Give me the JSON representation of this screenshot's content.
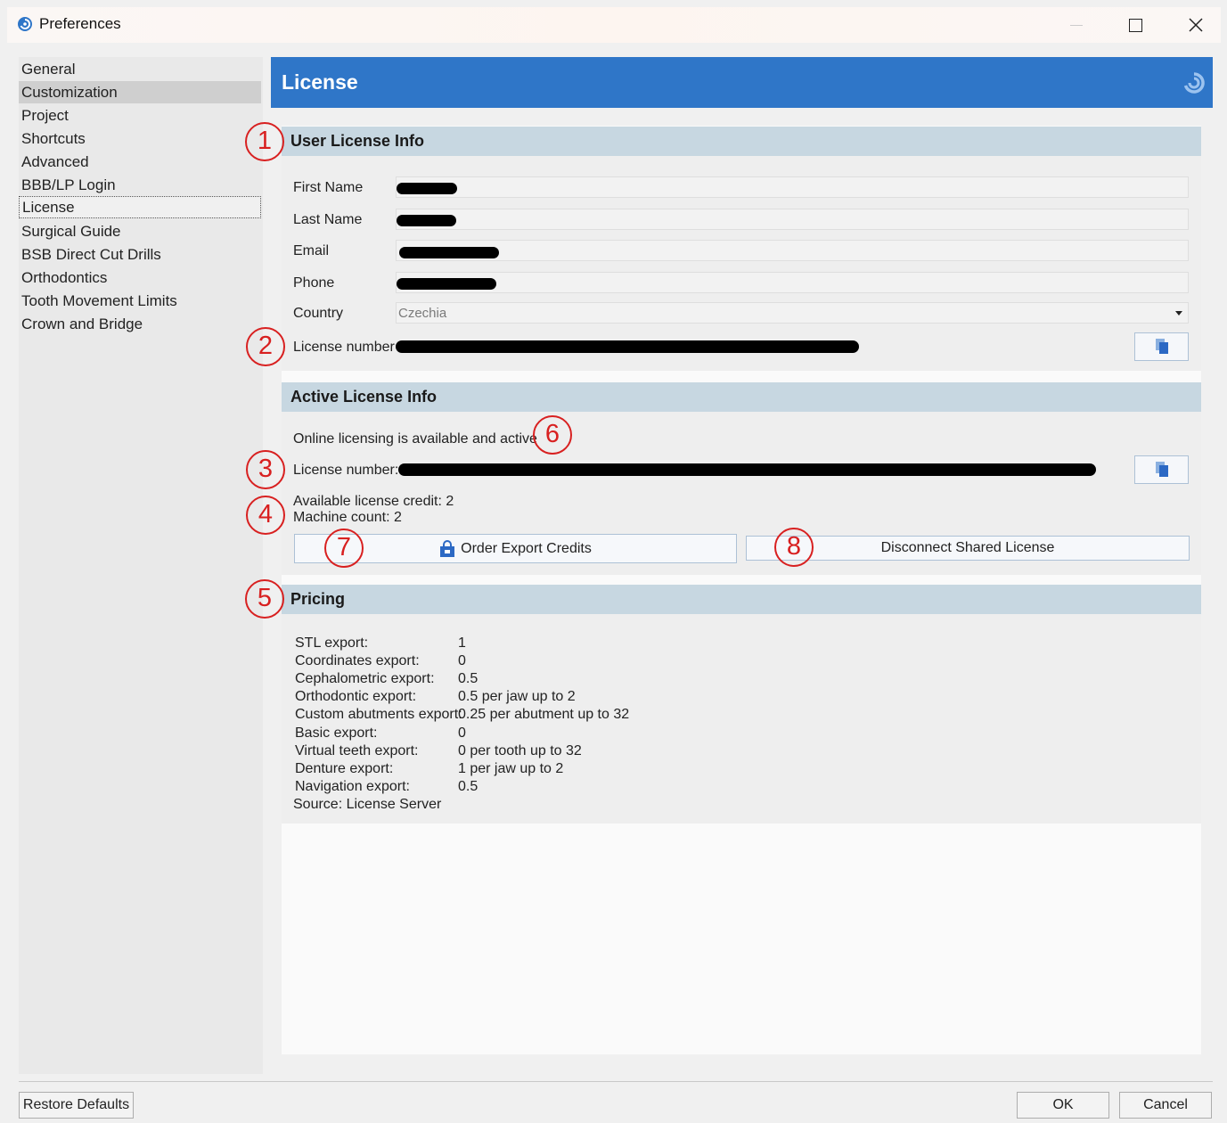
{
  "window": {
    "title": "Preferences"
  },
  "sidebar": {
    "items": [
      {
        "label": "General"
      },
      {
        "label": "Customization"
      },
      {
        "label": "Project"
      },
      {
        "label": "Shortcuts"
      },
      {
        "label": "Advanced"
      },
      {
        "label": "BBB/LP Login"
      },
      {
        "label": "License"
      },
      {
        "label": "Surgical Guide"
      },
      {
        "label": "BSB Direct Cut Drills"
      },
      {
        "label": "Orthodontics"
      },
      {
        "label": "Tooth Movement Limits"
      },
      {
        "label": "Crown and Bridge"
      }
    ],
    "selected": "Customization",
    "focused": "License"
  },
  "header": {
    "title": "License",
    "accent_color": "#2f76c8"
  },
  "user_license_info": {
    "title": "User License Info",
    "first_name_label": "First Name",
    "last_name_label": "Last Name",
    "email_label": "Email",
    "phone_label": "Phone",
    "country_label": "Country",
    "country_value": "Czechia",
    "license_number_label": "License number",
    "copy_icon": "copy-icon"
  },
  "active_license_info": {
    "title": "Active License Info",
    "status": "Online licensing is available and active",
    "license_number_label": "License number:",
    "credit_text": "Available license credit: 2",
    "machine_count_text": "Machine count: 2",
    "order_button": "Order Export Credits",
    "order_icon": "lock-bag-icon",
    "disconnect_button": "Disconnect Shared License"
  },
  "pricing": {
    "title": "Pricing",
    "rows": [
      {
        "label": "STL export:",
        "value": "1"
      },
      {
        "label": "Coordinates export:",
        "value": "0"
      },
      {
        "label": "Cephalometric export:",
        "value": "0.5"
      },
      {
        "label": "Orthodontic export:",
        "value": "0.5 per jaw up to 2"
      },
      {
        "label": "Custom abutments export:",
        "value": "0.25 per abutment up to 32"
      },
      {
        "label": "Basic export:",
        "value": "0"
      },
      {
        "label": "Virtual teeth export:",
        "value": "0 per tooth up to 32"
      },
      {
        "label": "Denture export:",
        "value": "1 per jaw up to 2"
      },
      {
        "label": "Navigation export:",
        "value": "0.5"
      }
    ],
    "source": "Source: License Server"
  },
  "annotations": [
    "1",
    "2",
    "3",
    "4",
    "5",
    "6",
    "7",
    "8"
  ],
  "annotation_color": "#d82020",
  "footer": {
    "restore_defaults": "Restore Defaults",
    "ok": "OK",
    "cancel": "Cancel"
  }
}
